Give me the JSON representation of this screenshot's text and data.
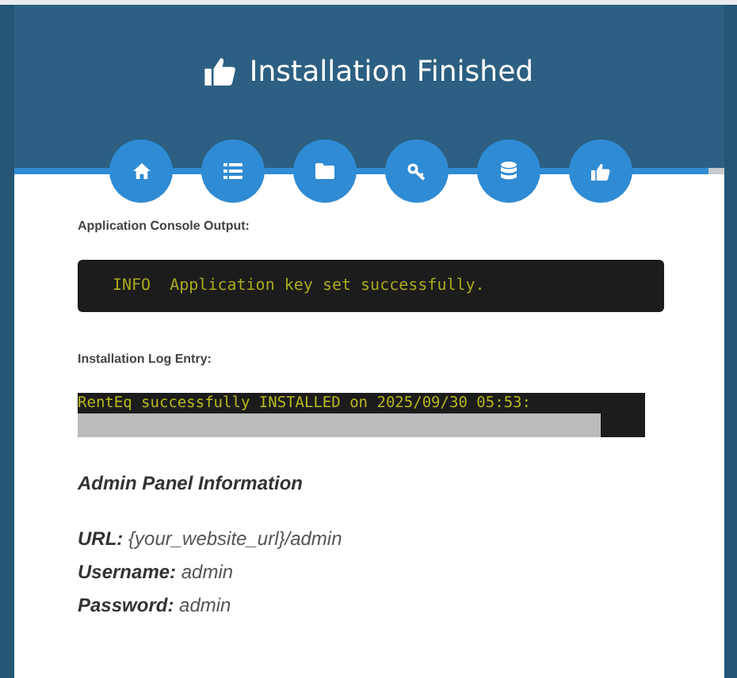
{
  "header": {
    "title": "Installation Finished"
  },
  "steps": [
    {
      "kind": "home",
      "completed": true
    },
    {
      "kind": "list",
      "completed": true
    },
    {
      "kind": "folder",
      "completed": true
    },
    {
      "kind": "key",
      "completed": true
    },
    {
      "kind": "database",
      "completed": true
    },
    {
      "kind": "thumb",
      "completed": true
    }
  ],
  "console": {
    "label": "Application Console Output:",
    "output": "INFO  Application key set successfully."
  },
  "log": {
    "label": "Installation Log Entry:",
    "entry": "RentEq successfully INSTALLED on 2025/09/30 05:53:"
  },
  "admin": {
    "heading": "Admin Panel Information",
    "fields": [
      {
        "label": "URL:",
        "value": "{your_website_url}/admin"
      },
      {
        "label": "Username:",
        "value": "admin"
      },
      {
        "label": "Password:",
        "value": "admin"
      }
    ]
  }
}
